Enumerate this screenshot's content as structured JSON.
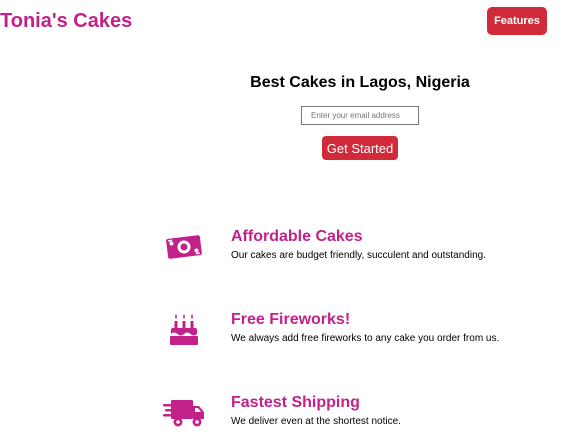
{
  "header": {
    "brand": "Tonia's Cakes",
    "nav_button": "Features"
  },
  "hero": {
    "title": "Best Cakes in Lagos, Nigeria",
    "email_placeholder": "Enter your email address",
    "cta_label": "Get Started"
  },
  "features": [
    {
      "icon": "money-bill-icon",
      "title": "Affordable Cakes",
      "description": "Our cakes are budget friendly, succulent and outstanding."
    },
    {
      "icon": "birthday-cake-icon",
      "title": "Free Fireworks!",
      "description": "We always add free fireworks to any cake you order from us."
    },
    {
      "icon": "shipping-truck-icon",
      "title": "Fastest Shipping",
      "description": "We deliver even at the shortest notice."
    }
  ],
  "colors": {
    "brand": "#c2218a",
    "button": "#d12b3a"
  }
}
